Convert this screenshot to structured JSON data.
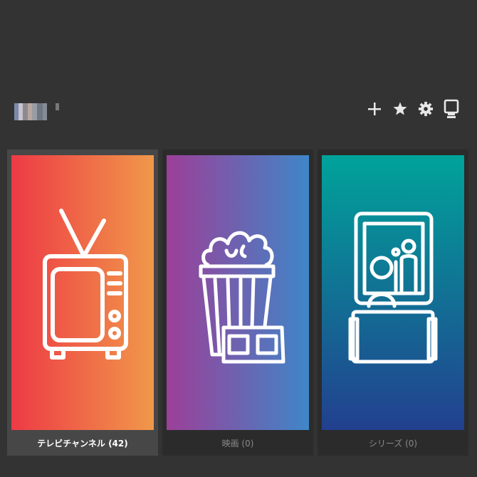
{
  "colors": {
    "background": "#333333",
    "tv_gradient": [
      "#ee3a45",
      "#f0984a"
    ],
    "movies_gradient": [
      "#9c3f98",
      "#3f86c8"
    ],
    "series_gradient": [
      "#00a39a",
      "#22408f"
    ]
  },
  "toolbar": {
    "icons": [
      "plus-icon",
      "star-icon",
      "gear-icon",
      "monitor-icon"
    ]
  },
  "categories": [
    {
      "label": "テレビチャンネル (42)",
      "icon": "tv-icon",
      "selected": true
    },
    {
      "label": "映画 (0)",
      "icon": "popcorn-3d-glasses-icon",
      "selected": false
    },
    {
      "label": "シリーズ (0)",
      "icon": "cinema-viewer-icon",
      "selected": false
    }
  ]
}
